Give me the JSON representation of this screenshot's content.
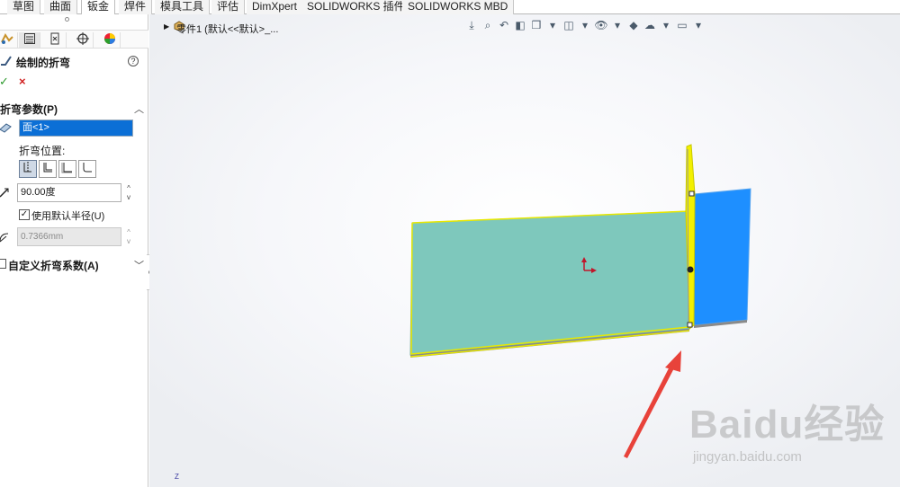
{
  "tabs": [
    {
      "label": "草图",
      "active": false
    },
    {
      "label": "曲面",
      "active": false
    },
    {
      "label": "钣金",
      "active": true
    },
    {
      "label": "焊件",
      "active": false
    },
    {
      "label": "模具工具",
      "active": false
    },
    {
      "label": "评估",
      "active": false
    },
    {
      "label": "DimXpert",
      "active": false
    },
    {
      "label": "SOLIDWORKS 插件",
      "active": false
    },
    {
      "label": "SOLIDWORKS MBD",
      "active": false
    }
  ],
  "panel": {
    "icons": [
      "feature-manager-icon",
      "property-manager-icon",
      "configuration-manager-icon",
      "dimxpert-icon",
      "appearance-icon"
    ],
    "feature_title": "绘制的折弯",
    "help_glyph": "?",
    "ok_glyph": "✓",
    "cancel_glyph": "×",
    "section_header": "折弯参数(P)",
    "face_selection": "面<1>",
    "bend_position_label": "折弯位置:",
    "bend_position_selected": 0,
    "angle_value": "90.00度",
    "use_default_radius_label": "使用默认半径(U)",
    "use_default_radius_checked": true,
    "radius_value": "0.7366mm",
    "custom_bend_allowance_label": "自定义折弯系数(A)",
    "custom_bend_allowance_checked": false
  },
  "viewport": {
    "tree_label": "零件1  (默认<<默认>_...",
    "heads_up_icons": [
      "zoom-to-fit-icon",
      "zoom-area-icon",
      "previous-view-icon",
      "section-view-icon",
      "view-orientation-icon",
      "display-style-icon",
      "hide-show-icon",
      "edit-appearance-icon",
      "apply-scene-icon",
      "view-settings-icon"
    ],
    "triad_label": "Z",
    "colors": {
      "flat_face": "#7ec8bc",
      "bent_face": "#1e8fff",
      "highlight": "#f2f000",
      "arrow": "#e8423a"
    }
  },
  "watermark": {
    "logo": "Baidu经验",
    "sub": "jingyan.baidu.com"
  }
}
